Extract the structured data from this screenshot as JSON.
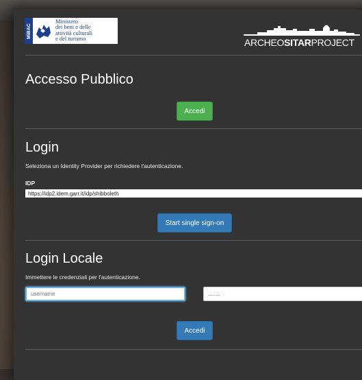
{
  "header": {
    "mibac_logo": {
      "side_text": "MiBAC",
      "line1": "Ministero",
      "line2": "dei beni e delle",
      "line3": "attività culturali",
      "line4": "e del turismo"
    },
    "archeo_logo": {
      "part1": "ARCHEO",
      "part2": "SITAR",
      "part3": "PROJECT"
    }
  },
  "public_access": {
    "title": "Accesso Pubblico",
    "button_label": "Accedi"
  },
  "sso_login": {
    "title": "Login",
    "description": "Seleziona un Identity Provider per richiedere l'autenticazione.",
    "idp_label": "IDP",
    "idp_selected": "https://idp2.idem.garr.it/idp/shibboleth",
    "button_label": "Start single sign-on"
  },
  "local_login": {
    "title": "Login Locale",
    "description": "Immettere le credenziali per l'autenticazione.",
    "username_placeholder": "username",
    "password_value": "........",
    "button_label": "Accedi"
  },
  "colors": {
    "panel": "#333333",
    "green_button": "#4caf50",
    "blue_button": "#337ab7",
    "focus_border": "#66afe9"
  }
}
